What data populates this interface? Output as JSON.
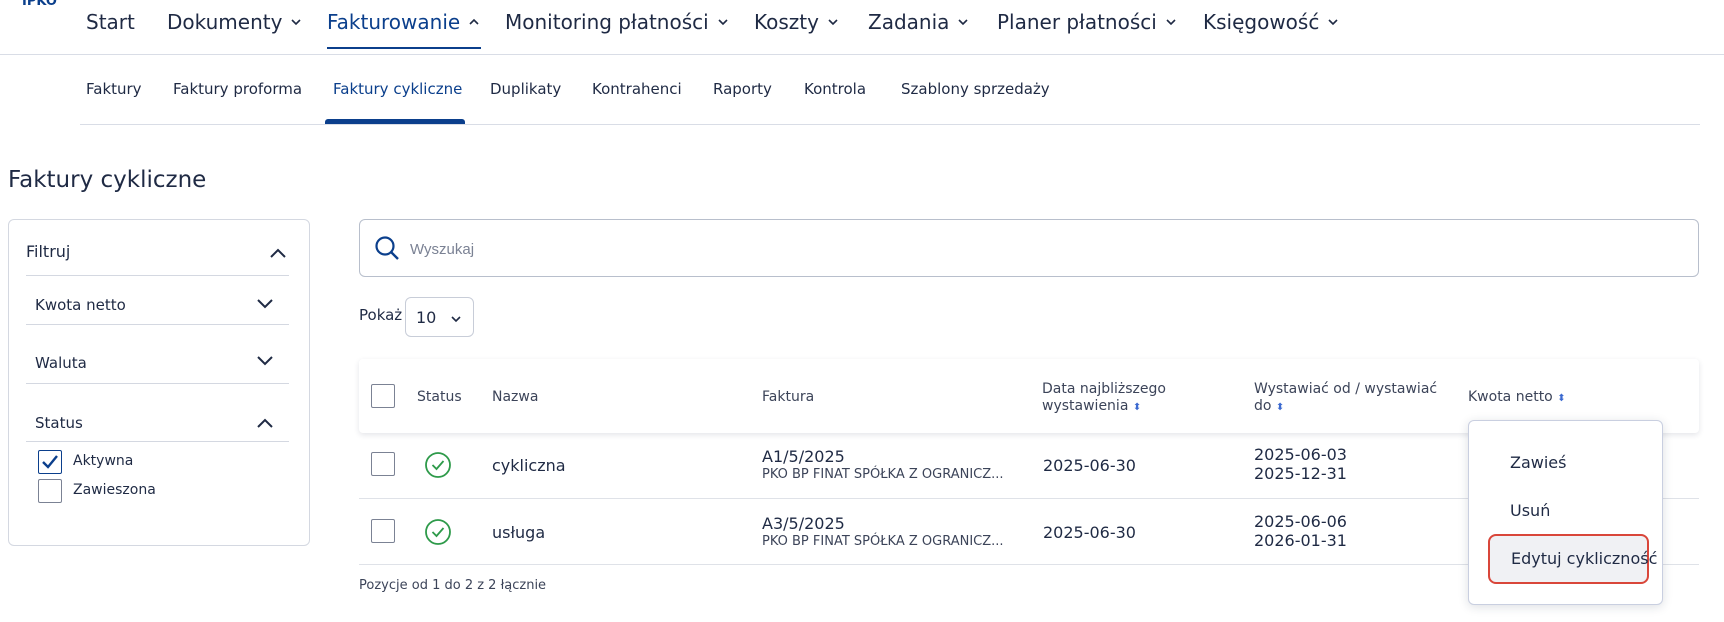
{
  "logo": "IPKO",
  "topnav": [
    {
      "label": "Start",
      "chevron": "none"
    },
    {
      "label": "Dokumenty",
      "chevron": "down"
    },
    {
      "label": "Fakturowanie",
      "chevron": "up"
    },
    {
      "label": "Monitoring płatności",
      "chevron": "down"
    },
    {
      "label": "Koszty",
      "chevron": "down"
    },
    {
      "label": "Zadania",
      "chevron": "down"
    },
    {
      "label": "Planer płatności",
      "chevron": "down"
    },
    {
      "label": "Księgowość",
      "chevron": "down"
    }
  ],
  "subnav": [
    "Faktury",
    "Faktury proforma",
    "Faktury cykliczne",
    "Duplikaty",
    "Kontrahenci",
    "Raporty",
    "Kontrola",
    "Szablony sprzedaży"
  ],
  "page_title": "Faktury cykliczne",
  "filter": {
    "title": "Filtruj",
    "sections": [
      "Kwota netto",
      "Waluta",
      "Status"
    ],
    "status_options": [
      {
        "label": "Aktywna",
        "checked": true
      },
      {
        "label": "Zawieszona",
        "checked": false
      }
    ]
  },
  "search": {
    "placeholder": "Wyszukaj"
  },
  "show": {
    "label": "Pokaż",
    "value": "10"
  },
  "table": {
    "headers": {
      "status": "Status",
      "name": "Nazwa",
      "invoice": "Faktura",
      "next_date_1": "Data najbliższego",
      "next_date_2": "wystawienia",
      "issue_1": "Wystawiać od / wystawiać",
      "issue_2": "do",
      "amount": "Kwota netto"
    },
    "rows": [
      {
        "name": "cykliczna",
        "invoice": "A1/5/2025",
        "company": "PKO BP FINAT SPÓŁKA Z OGRANICZ...",
        "next_date": "2025-06-30",
        "from": "2025-06-03",
        "to": "2025-12-31"
      },
      {
        "name": "usługa",
        "invoice": "A3/5/2025",
        "company": "PKO BP FINAT SPÓŁKA Z OGRANICZ...",
        "next_date": "2025-06-30",
        "from": "2025-06-06",
        "to": "2026-01-31"
      }
    ]
  },
  "footer": "Pozycje od 1 do 2 z 2 łącznie",
  "context_menu": [
    "Zawieś",
    "Usuń",
    "Edytuj cykliczność"
  ],
  "colors": {
    "primary": "#0b3f8c",
    "status_active": "#2e9a4a",
    "highlight": "#d9463a"
  }
}
